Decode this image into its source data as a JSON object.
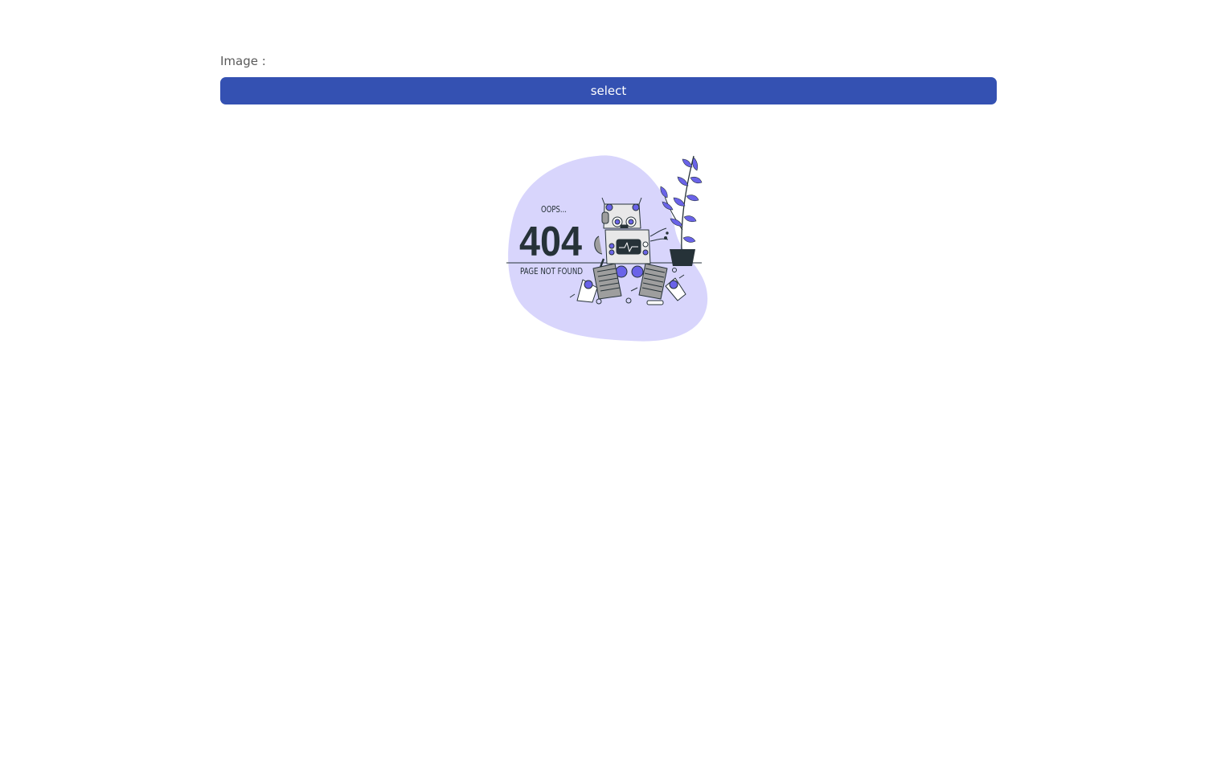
{
  "form": {
    "image_label": "Image :",
    "select_label": "select"
  },
  "illustration": {
    "oops_text": "OOPS...",
    "code_text": "404",
    "message_text": "PAGE NOT FOUND"
  },
  "colors": {
    "accent": "#3451b2",
    "blob": "#d8d5fc",
    "plant": "#6a63e8",
    "dark": "#263238"
  }
}
